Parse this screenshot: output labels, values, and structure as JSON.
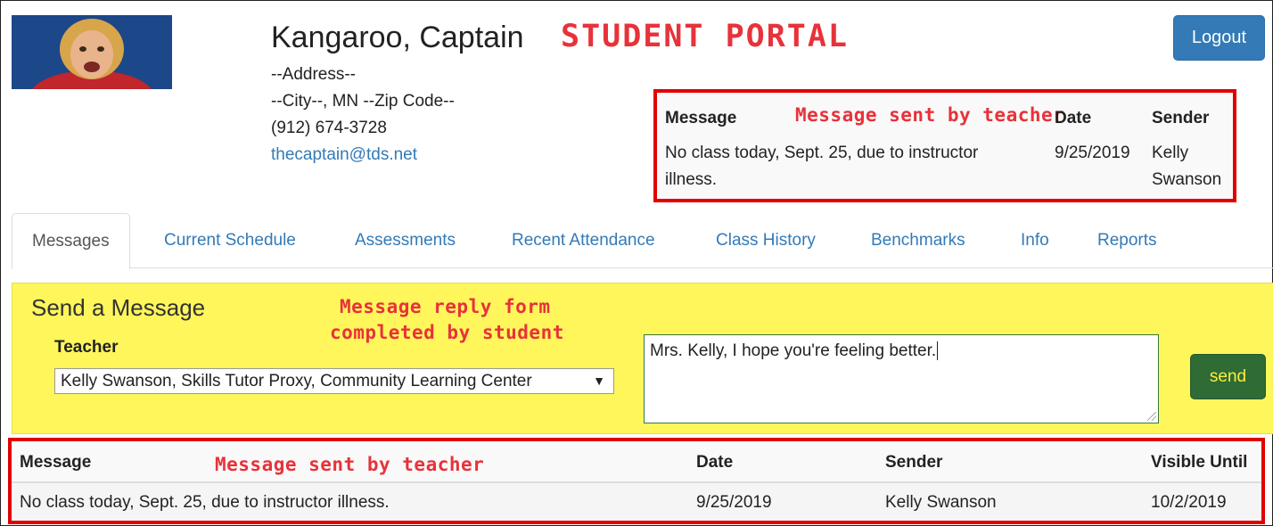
{
  "header": {
    "student_name": "Kangaroo, Captain",
    "portal_label": "STUDENT PORTAL",
    "address_line": "--Address--",
    "city_line": "--City--, MN --Zip Code--",
    "phone": "(912) 674-3728",
    "email": "thecaptain@tds.net",
    "logout_label": "Logout"
  },
  "top_message": {
    "annotation": "Message sent by teacher",
    "headers": {
      "message": "Message",
      "date": "Date",
      "sender": "Sender"
    },
    "row": {
      "message_line1": "No class today, Sept. 25, due to instructor",
      "message_line2": "illness.",
      "date": "9/25/2019",
      "sender_line1": "Kelly",
      "sender_line2": "Swanson"
    }
  },
  "tabs": [
    {
      "label": "Messages",
      "active": true
    },
    {
      "label": "Current Schedule"
    },
    {
      "label": "Assessments"
    },
    {
      "label": "Recent Attendance"
    },
    {
      "label": "Class History"
    },
    {
      "label": "Benchmarks"
    },
    {
      "label": "Info"
    },
    {
      "label": "Reports"
    }
  ],
  "send_form": {
    "title": "Send a Message",
    "annotation_line1": "Message reply form",
    "annotation_line2": "completed by student",
    "teacher_label": "Teacher",
    "teacher_selected": "Kelly Swanson, Skills Tutor Proxy, Community Learning Center",
    "message_value": "Mrs. Kelly, I hope you're feeling better.",
    "send_label": "send"
  },
  "messages_table": {
    "annotation": "Message sent by teacher",
    "headers": {
      "message": "Message",
      "date": "Date",
      "sender": "Sender",
      "visible_until": "Visible Until"
    },
    "rows": [
      {
        "message": "No class today, Sept. 25, due to instructor illness.",
        "date": "9/25/2019",
        "sender": "Kelly Swanson",
        "visible_until": "10/2/2019"
      }
    ]
  },
  "colors": {
    "accent_blue": "#337ab7",
    "annotation_red": "#e8323a",
    "panel_yellow": "#fef65b",
    "send_green": "#2e6b35"
  }
}
